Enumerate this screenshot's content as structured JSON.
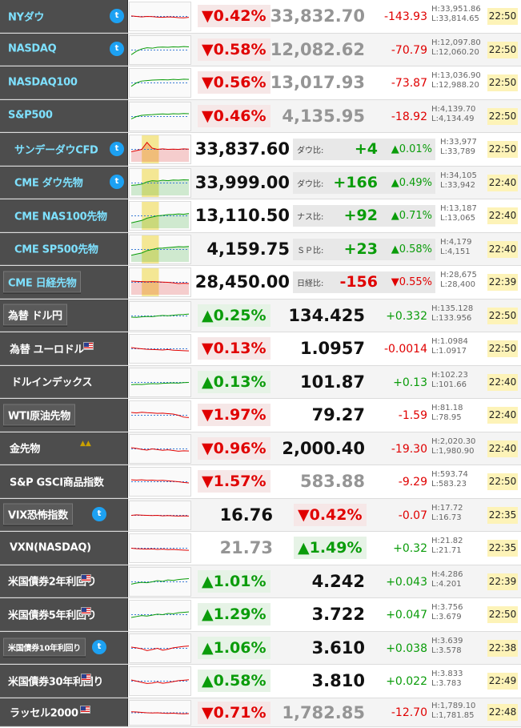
{
  "colors": {
    "down": "#e00000",
    "up": "#0a9c0a",
    "name_bg": "#4d4d4d",
    "name_blue": "#7ee1ff",
    "time_bg": "#fdf3b8"
  },
  "rows": [
    {
      "name": "NYダウ",
      "pct": "▼0.42%",
      "dir": "down",
      "price": "33,832.70",
      "chg": "-143.93",
      "high": "H:33,951.86",
      "low": "L:33,814.65",
      "time": "22:50",
      "chart": [
        0.52,
        0.5,
        0.48,
        0.5,
        0.49,
        0.47,
        0.46,
        0.48,
        0.47,
        0.45,
        0.44,
        0.46
      ],
      "chart_color": "#e00000",
      "area": false
    },
    {
      "name": "NASDAQ",
      "pct": "▼0.58%",
      "dir": "down",
      "price": "12,082.62",
      "chg": "-70.79",
      "high": "H:12,097.80",
      "low": "L:12,060.20",
      "time": "22:50",
      "chart": [
        0.3,
        0.45,
        0.55,
        0.6,
        0.58,
        0.62,
        0.63,
        0.62,
        0.64,
        0.63,
        0.65,
        0.64
      ],
      "chart_color": "#0a9c0a",
      "area": false
    },
    {
      "name": "NASDAQ100",
      "pct": "▼0.56%",
      "dir": "down",
      "price": "13,017.93",
      "chg": "-73.87",
      "high": "H:13,036.90",
      "low": "L:12,988.20",
      "time": "22:50",
      "chart": [
        0.35,
        0.5,
        0.58,
        0.6,
        0.62,
        0.63,
        0.64,
        0.63,
        0.65,
        0.64,
        0.66,
        0.65
      ],
      "chart_color": "#0a9c0a",
      "area": false
    },
    {
      "name": "S&P500",
      "pct": "▼0.46%",
      "dir": "down",
      "price": "4,135.95",
      "chg": "-18.92",
      "high": "H:4,139.70",
      "low": "L:4,134.49",
      "time": "22:50",
      "chart": [
        0.4,
        0.5,
        0.55,
        0.57,
        0.58,
        0.6,
        0.61,
        0.6,
        0.62,
        0.61,
        0.63,
        0.62
      ],
      "chart_color": "#0a9c0a",
      "area": false
    },
    {
      "name": "サンデーダウCFD",
      "price": "33,837.60",
      "ratio_label": "ダウ比:",
      "ratio_pts": "+4",
      "ratio_pct": "▲0.01%",
      "dir": "up",
      "high": "H:33,977",
      "low": "L:33,789",
      "time": "22:50",
      "chart": [
        0.4,
        0.45,
        0.5,
        0.8,
        0.55,
        0.5,
        0.52,
        0.5,
        0.51,
        0.5,
        0.52,
        0.51
      ],
      "chart_color": "#e00000",
      "area": true
    },
    {
      "name": "CME ダウ先物",
      "price": "33,999.00",
      "ratio_label": "ダウ比:",
      "ratio_pts": "+166",
      "ratio_pct": "▲0.49%",
      "dir": "up",
      "high": "H:34,105",
      "low": "L:33,942",
      "time": "22:40",
      "chart": [
        0.4,
        0.42,
        0.45,
        0.55,
        0.6,
        0.58,
        0.62,
        0.6,
        0.63,
        0.62,
        0.64,
        0.63
      ],
      "chart_color": "#0a9c0a",
      "area": true
    },
    {
      "name": "CME NAS100先物",
      "price": "13,110.50",
      "ratio_label": "ナス比:",
      "ratio_pts": "+92",
      "ratio_pct": "▲0.71%",
      "dir": "up",
      "high": "H:13,187",
      "low": "L:13,065",
      "time": "22:40",
      "chart": [
        0.2,
        0.25,
        0.3,
        0.4,
        0.45,
        0.5,
        0.52,
        0.55,
        0.56,
        0.58,
        0.57,
        0.6
      ],
      "chart_color": "#0a9c0a",
      "area": true
    },
    {
      "name": "CME SP500先物",
      "price": "4,159.75",
      "ratio_label": "ＳＰ比:",
      "ratio_pts": "+23",
      "ratio_pct": "▲0.58%",
      "dir": "up",
      "high": "H:4,179",
      "low": "L:4,151",
      "time": "22:40",
      "chart": [
        0.25,
        0.3,
        0.35,
        0.45,
        0.5,
        0.55,
        0.56,
        0.58,
        0.6,
        0.62,
        0.61,
        0.63
      ],
      "chart_color": "#0a9c0a",
      "area": true
    },
    {
      "name": "CME 日経先物",
      "price": "28,450.00",
      "ratio_label": "日経比:",
      "ratio_pts": "-156",
      "ratio_pct": "▼0.55%",
      "dir": "down",
      "high": "H:28,675",
      "low": "L:28,400",
      "time": "22:39",
      "chart": [
        0.55,
        0.54,
        0.53,
        0.52,
        0.53,
        0.52,
        0.51,
        0.5,
        0.48,
        0.45,
        0.46,
        0.45
      ],
      "chart_color": "#e00000",
      "area": true
    },
    {
      "name": "為替 ドル円",
      "pct": "▲0.25%",
      "dir": "up",
      "price": "134.425",
      "chg": "+0.332",
      "high": "H:135.128",
      "low": "L:133.956",
      "time": "22:50",
      "chart": [
        0.45,
        0.44,
        0.46,
        0.48,
        0.47,
        0.5,
        0.52,
        0.51,
        0.53,
        0.55,
        0.56,
        0.58
      ],
      "chart_color": "#0a9c0a",
      "area": false
    },
    {
      "name": "為替 ユーロドル",
      "pct": "▼0.13%",
      "dir": "down",
      "price": "1.0957",
      "chg": "-0.0014",
      "high": "H:1.0984",
      "low": "L:1.0917",
      "time": "22:50",
      "chart": [
        0.55,
        0.52,
        0.5,
        0.48,
        0.47,
        0.46,
        0.45,
        0.47,
        0.44,
        0.43,
        0.42,
        0.41
      ],
      "chart_color": "#e00000",
      "area": false
    },
    {
      "name": "ドルインデックス",
      "pct": "▲0.13%",
      "dir": "up",
      "price": "101.87",
      "chg": "+0.13",
      "high": "H:102.23",
      "low": "L:101.66",
      "time": "22:40",
      "chart": [
        0.4,
        0.42,
        0.41,
        0.43,
        0.45,
        0.44,
        0.46,
        0.47,
        0.48,
        0.47,
        0.49,
        0.5
      ],
      "chart_color": "#0a9c0a",
      "area": false
    },
    {
      "name": "WTI原油先物",
      "pct": "▼1.97%",
      "dir": "down",
      "price": "79.27",
      "chg": "-1.59",
      "high": "H:81.18",
      "low": "L:78.95",
      "time": "22:40",
      "chart": [
        0.62,
        0.6,
        0.63,
        0.61,
        0.6,
        0.58,
        0.59,
        0.57,
        0.55,
        0.5,
        0.42,
        0.4
      ],
      "chart_color": "#e00000",
      "area": false
    },
    {
      "name": "金先物",
      "pct": "▼0.96%",
      "dir": "down",
      "price": "2,000.40",
      "chg": "-19.30",
      "high": "H:2,020.30",
      "low": "L:1,980.90",
      "time": "22:40",
      "chart": [
        0.55,
        0.52,
        0.48,
        0.45,
        0.5,
        0.47,
        0.44,
        0.46,
        0.43,
        0.4,
        0.42,
        0.41
      ],
      "chart_color": "#e00000",
      "area": false
    },
    {
      "name": "S&P GSCI商品指数",
      "pct": "▼1.57%",
      "dir": "down",
      "price": "583.88",
      "chg": "-9.29",
      "high": "H:593.74",
      "low": "L:583.23",
      "time": "22:50",
      "chart": [
        0.58,
        0.57,
        0.58,
        0.56,
        0.57,
        0.55,
        0.56,
        0.54,
        0.52,
        0.5,
        0.47,
        0.45
      ],
      "chart_color": "#e00000",
      "area": false
    },
    {
      "name": "VIX恐怖指数",
      "price": "16.76",
      "pct": "▼0.42%",
      "dir": "down",
      "chg": "-0.07",
      "high": "H:17.72",
      "low": "L:16.73",
      "time": "22:35",
      "chart": [
        0.5,
        0.52,
        0.51,
        0.5,
        0.49,
        0.5,
        0.48,
        0.49,
        0.48,
        0.47,
        0.48,
        0.47
      ],
      "chart_color": "#e00000",
      "area": false
    },
    {
      "name": "VXN(NASDAQ)",
      "price": "21.73",
      "pct": "▲1.49%",
      "dir": "up",
      "chg": "+0.32",
      "high": "H:21.82",
      "low": "L:21.71",
      "time": "22:35",
      "chart": [
        0.5,
        0.48,
        0.47,
        0.46,
        0.47,
        0.45,
        0.46,
        0.44,
        0.45,
        0.43,
        0.42,
        0.41
      ],
      "chart_color": "#e00000",
      "area": false
    },
    {
      "name": "米国債券2年利回り",
      "pct": "▲1.01%",
      "dir": "up",
      "price": "4.242",
      "chg": "+0.043",
      "high": "H:4.286",
      "low": "L:4.201",
      "time": "22:39",
      "chart": [
        0.4,
        0.45,
        0.48,
        0.46,
        0.5,
        0.55,
        0.52,
        0.58,
        0.56,
        0.6,
        0.62,
        0.64
      ],
      "chart_color": "#0a9c0a",
      "area": false
    },
    {
      "name": "米国債券5年利回り",
      "pct": "▲1.29%",
      "dir": "up",
      "price": "3.722",
      "chg": "+0.047",
      "high": "H:3.756",
      "low": "L:3.679",
      "time": "22:50",
      "chart": [
        0.38,
        0.42,
        0.46,
        0.44,
        0.48,
        0.52,
        0.5,
        0.55,
        0.54,
        0.58,
        0.6,
        0.62
      ],
      "chart_color": "#0a9c0a",
      "area": false
    },
    {
      "name": "米国債券10年利回り",
      "pct": "▲1.06%",
      "dir": "up",
      "price": "3.610",
      "chg": "+0.038",
      "high": "H:3.639",
      "low": "L:3.578",
      "time": "22:38",
      "chart": [
        0.55,
        0.52,
        0.48,
        0.4,
        0.45,
        0.5,
        0.42,
        0.46,
        0.52,
        0.55,
        0.58,
        0.6
      ],
      "chart_color": "#e00000",
      "area": false
    },
    {
      "name": "米国債券30年利回り",
      "pct": "▲0.58%",
      "dir": "up",
      "price": "3.810",
      "chg": "+0.022",
      "high": "H:3.833",
      "low": "L:3.783",
      "time": "22:49",
      "chart": [
        0.55,
        0.5,
        0.45,
        0.4,
        0.42,
        0.46,
        0.41,
        0.44,
        0.48,
        0.52,
        0.54,
        0.56
      ],
      "chart_color": "#e00000",
      "area": false
    },
    {
      "name": "ラッセル2000",
      "pct": "▼0.71%",
      "dir": "down",
      "price": "1,782.85",
      "chg": "-12.70",
      "high": "H:1,789.10",
      "low": "L:1,781.85",
      "time": "22:48",
      "chart": [
        0.55,
        0.54,
        0.52,
        0.5,
        0.49,
        0.5,
        0.48,
        0.47,
        0.48,
        0.46,
        0.45,
        0.46
      ],
      "chart_color": "#e00000",
      "area": false
    }
  ]
}
